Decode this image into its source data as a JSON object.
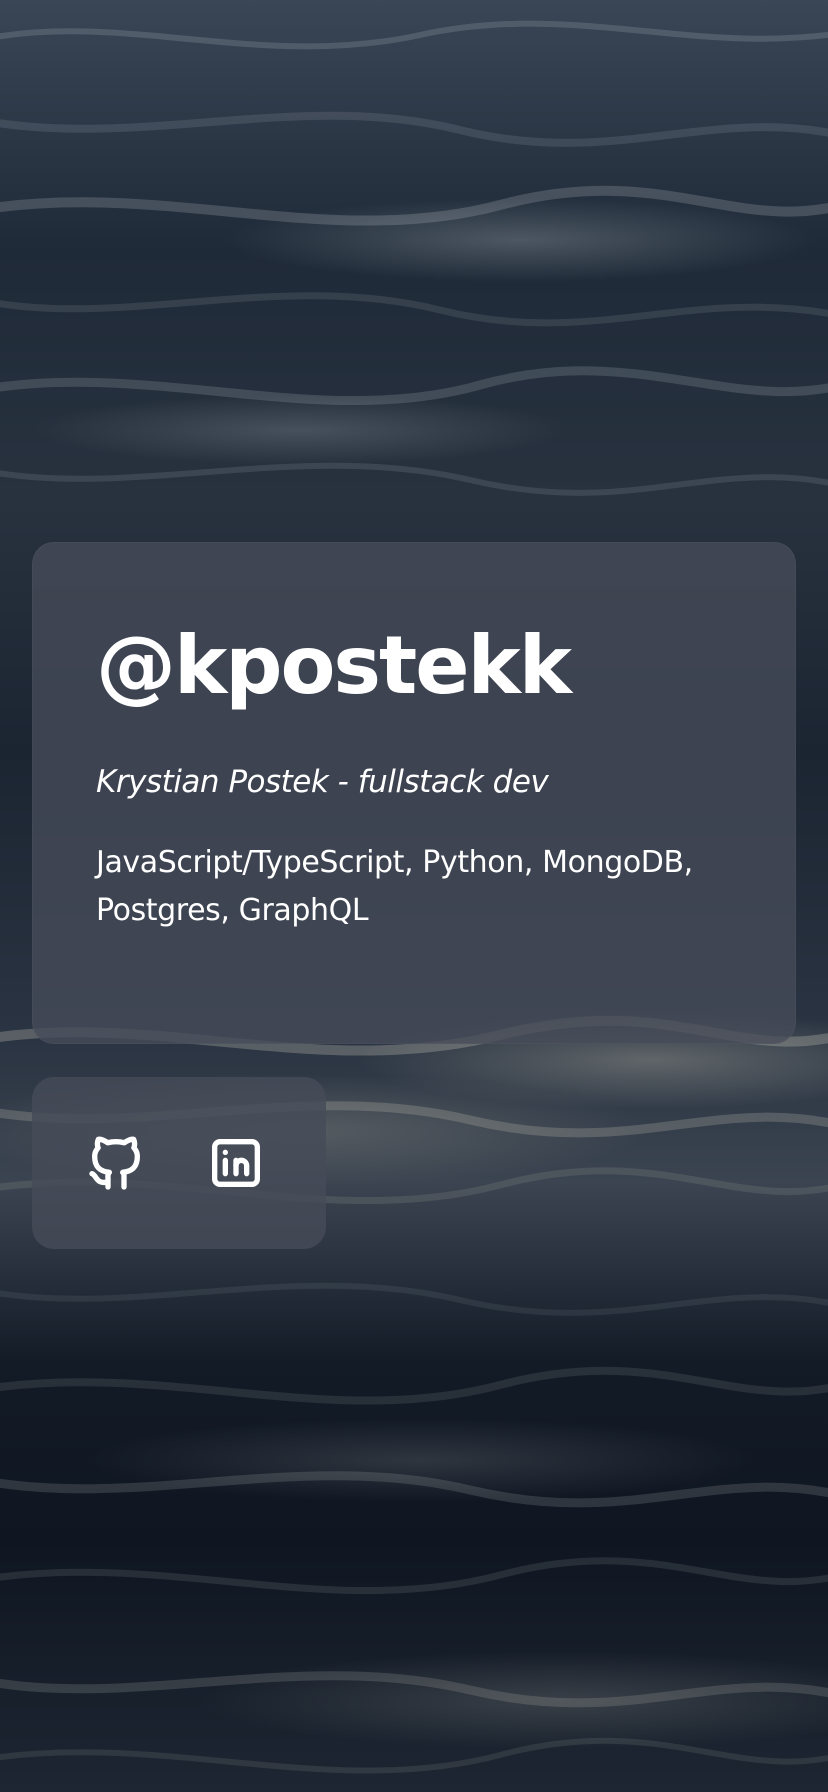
{
  "profile": {
    "handle": "@kpostekk",
    "subtitle": "Krystian Postek - fullstack dev",
    "skills": "JavaScript/TypeScript, Python, MongoDB, Postgres, GraphQL"
  },
  "social": {
    "items": [
      {
        "icon": "github-icon"
      },
      {
        "icon": "linkedin-icon"
      }
    ]
  },
  "colors": {
    "card_background": "#464c58",
    "text": "#ffffff",
    "water_dark": "#141c27"
  }
}
